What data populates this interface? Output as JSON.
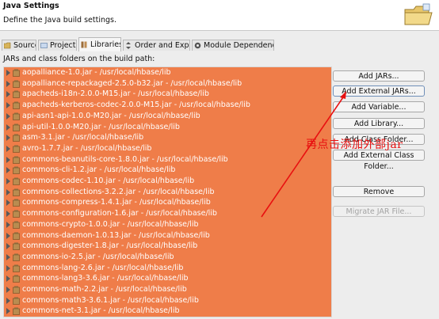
{
  "window": {
    "title": "Java Settings",
    "description": "Define the Java build settings."
  },
  "tabs": [
    {
      "label": "Source",
      "icon": "source-folder-icon",
      "active": false
    },
    {
      "label": "Projects",
      "icon": "projects-icon",
      "active": false
    },
    {
      "label": "Libraries",
      "icon": "libraries-icon",
      "active": true
    },
    {
      "label": "Order and Export",
      "icon": "order-export-icon",
      "active": false
    },
    {
      "label": "Module Dependencies",
      "icon": "module-dependencies-icon",
      "active": false
    }
  ],
  "libraries": {
    "label": "JARs and class folders on the build path:",
    "items": [
      "aopalliance-1.0.jar - /usr/local/hbase/lib",
      "aopalliance-repackaged-2.5.0-b32.jar - /usr/local/hbase/lib",
      "apacheds-i18n-2.0.0-M15.jar - /usr/local/hbase/lib",
      "apacheds-kerberos-codec-2.0.0-M15.jar - /usr/local/hbase/lib",
      "api-asn1-api-1.0.0-M20.jar - /usr/local/hbase/lib",
      "api-util-1.0.0-M20.jar - /usr/local/hbase/lib",
      "asm-3.1.jar - /usr/local/hbase/lib",
      "avro-1.7.7.jar - /usr/local/hbase/lib",
      "commons-beanutils-core-1.8.0.jar - /usr/local/hbase/lib",
      "commons-cli-1.2.jar - /usr/local/hbase/lib",
      "commons-codec-1.10.jar - /usr/local/hbase/lib",
      "commons-collections-3.2.2.jar - /usr/local/hbase/lib",
      "commons-compress-1.4.1.jar - /usr/local/hbase/lib",
      "commons-configuration-1.6.jar - /usr/local/hbase/lib",
      "commons-crypto-1.0.0.jar - /usr/local/hbase/lib",
      "commons-daemon-1.0.13.jar - /usr/local/hbase/lib",
      "commons-digester-1.8.jar - /usr/local/hbase/lib",
      "commons-io-2.5.jar - /usr/local/hbase/lib",
      "commons-lang-2.6.jar - /usr/local/hbase/lib",
      "commons-lang3-3.6.jar - /usr/local/hbase/lib",
      "commons-math-2.2.jar - /usr/local/hbase/lib",
      "commons-math3-3.6.1.jar - /usr/local/hbase/lib",
      "commons-net-3.1.jar - /usr/local/hbase/lib"
    ],
    "selection_color": "#ef7d49"
  },
  "buttons": {
    "add_jars": "Add JARs...",
    "add_external_jars": "Add External JARs...",
    "add_variable": "Add Variable...",
    "add_library": "Add Library...",
    "add_class_folder": "Add Class Folder...",
    "add_external_class_folder": "Add External Class Folder...",
    "remove": "Remove",
    "migrate_jar_file": "Migrate JAR File..."
  },
  "annotation": {
    "text": "再点击添加外部jar",
    "color": "#e81010"
  }
}
